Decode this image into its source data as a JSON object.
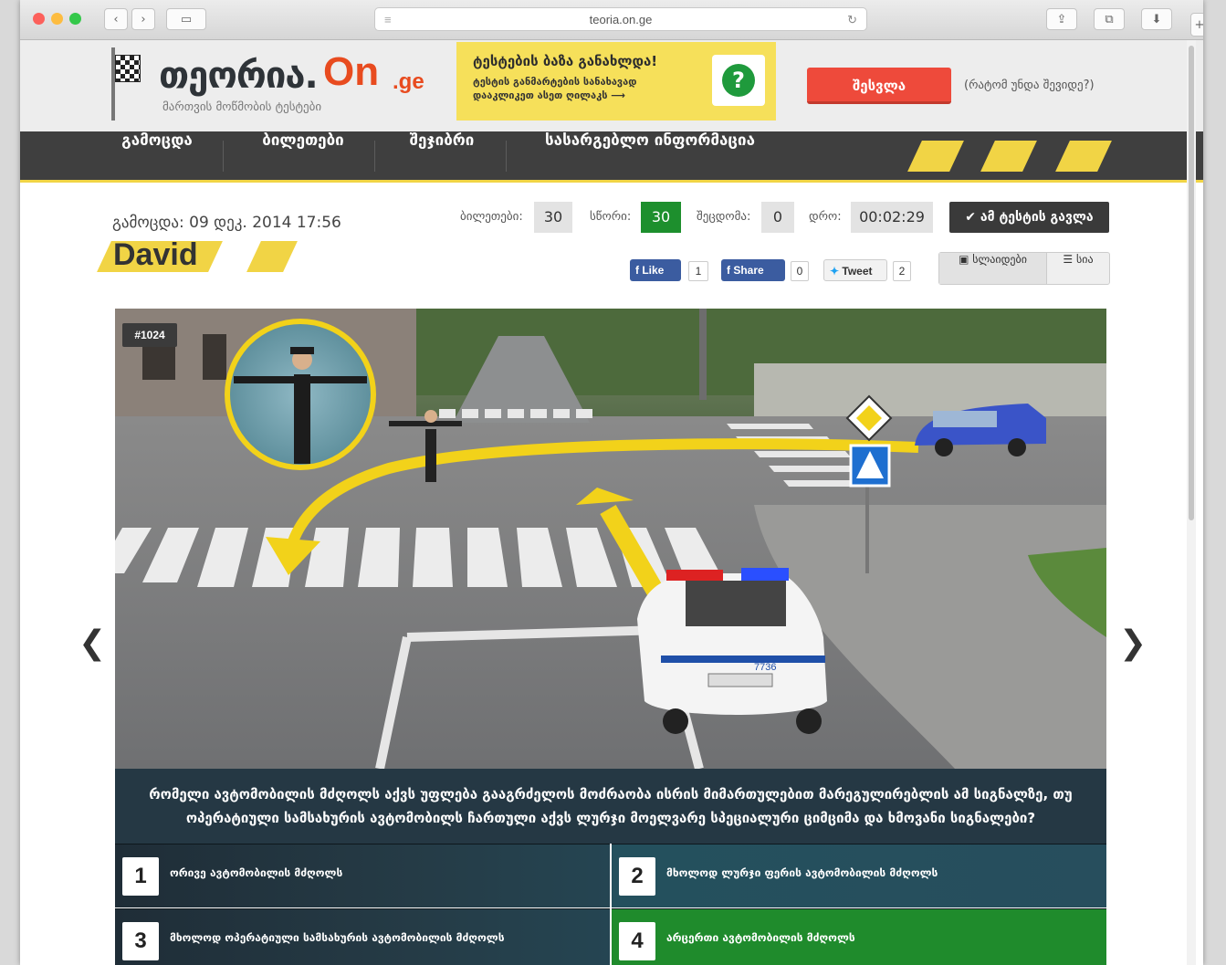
{
  "browser": {
    "url": "teoria.on.ge"
  },
  "logo": {
    "main": "თეორია.",
    "on": "On",
    "ge": ".ge",
    "tagline": "მართვის მოწმობის ტესტები"
  },
  "news": {
    "title": "ტესტების ბაზა განახლდა!",
    "text": "ტესტის განმარტების სანახავად დააკლიკეთ ასეთ ღილაკს ⟶",
    "help_symbol": "?"
  },
  "auth": {
    "login_label": "შესვლა",
    "why_label": "(რატომ უნდა შევიდე?)"
  },
  "nav": {
    "items": [
      "გამოცდა",
      "ბილეთები",
      "შეჯიბრი",
      "სასარგებლო ინფორმაცია"
    ]
  },
  "exam": {
    "date_label": "გამოცდა: 09 დეკ. 2014 17:56",
    "tickets_label": "ბილეთები:",
    "tickets_value": "30",
    "correct_label": "სწორი:",
    "correct_value": "30",
    "wrong_label": "შეცდომა:",
    "wrong_value": "0",
    "time_label": "დრო:",
    "time_value": "00:02:29",
    "finish_label": "✔ ამ ტესტის გავლა",
    "user_name": "David"
  },
  "social": {
    "like_label": "Like",
    "like_count": "1",
    "share_label": "Share",
    "share_count": "0",
    "tweet_label": "Tweet",
    "tweet_count": "2"
  },
  "view": {
    "images_label": "სლაიდები",
    "list_label": "სია"
  },
  "question": {
    "number": "#1024",
    "text": "რომელი ავტომობილის მძღოლს აქვს უფლება გააგრძელოს მოძრაობა ისრის მიმართულებით მარეგულირებლის ამ სიგნალზე, თუ ოპერატიული სამსახურის ავტომობილს ჩართული აქვს ლურჯი მოელვარე სპეციალური ციმციმა და ხმოვანი სიგნალები?",
    "prev_symbol": "❮",
    "next_symbol": "❯",
    "police_car_number": "7736"
  },
  "answers": [
    {
      "num": "1",
      "text": "ორივე ავტომობილის მძღოლს"
    },
    {
      "num": "2",
      "text": "მხოლოდ ლურჯი ფერის ავტომობილის მძღოლს"
    },
    {
      "num": "3",
      "text": "მხოლოდ ოპერატიული სამსახურის ავტომობილის მძღოლს"
    },
    {
      "num": "4",
      "text": "არცერთი ავტომობილის მძღოლს"
    }
  ],
  "colors": {
    "accent_yellow": "#f1d445",
    "login_red": "#ee4a3b",
    "correct_green": "#1f8b2c",
    "nav_dark": "#3f3f3f"
  }
}
